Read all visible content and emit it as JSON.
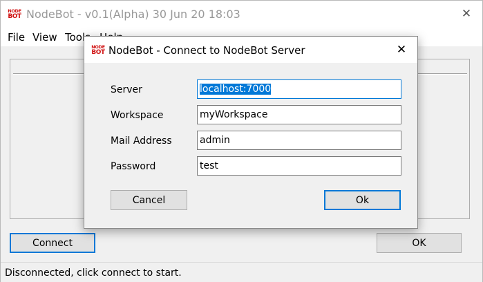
{
  "main_window": {
    "logo": {
      "line1": "NODE",
      "line2": "BOT"
    },
    "title": "NodeBot - v0.1(Alpha) 30 Jun 20 18:03",
    "close_glyph": "✕"
  },
  "menu": [
    {
      "label": "File"
    },
    {
      "label": "View"
    },
    {
      "label": "Tools"
    },
    {
      "label": "Help"
    }
  ],
  "buttons": {
    "connect": "Connect",
    "ok": "OK"
  },
  "status": {
    "text": "Disconnected, click connect to start."
  },
  "dialog": {
    "title": "NodeBot - Connect to NodeBot Server",
    "close_glyph": "✕",
    "fields": [
      {
        "label": "Server",
        "value": "localhost:7000"
      },
      {
        "label": "Workspace",
        "value": "myWorkspace"
      },
      {
        "label": "Mail Address",
        "value": "admin"
      },
      {
        "label": "Password",
        "value": "test"
      }
    ],
    "cancel_label": "Cancel",
    "ok_label": "Ok"
  },
  "colors": {
    "logo_red": "#d01010",
    "focus_blue": "#0078d7",
    "selection": "#0078d7",
    "button_face": "#e1e1e1"
  },
  "icons": {
    "logo": "nodebot-logo-icon",
    "close": "close-icon"
  }
}
